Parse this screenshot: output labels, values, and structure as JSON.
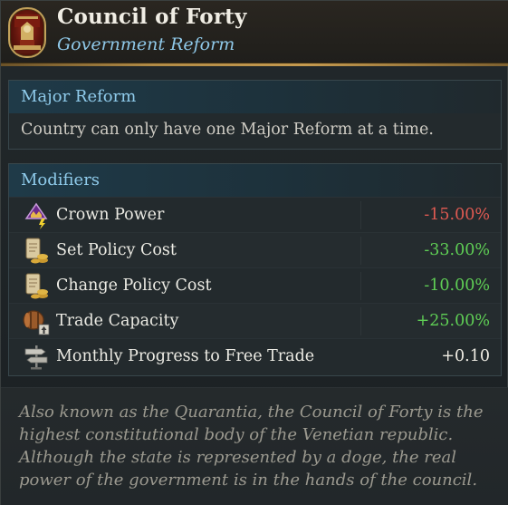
{
  "header": {
    "title": "Council of Forty",
    "subtitle": "Government Reform",
    "emblem_icon": "council-throne-icon",
    "accent_color": "#c59a4f"
  },
  "major_reform": {
    "heading": "Major Reform",
    "text": "Country can only have one Major Reform at a time."
  },
  "modifiers": {
    "heading": "Modifiers",
    "items": [
      {
        "icon": "crown-power-icon",
        "label": "Crown Power",
        "value": "-15.00%",
        "tone": "negative"
      },
      {
        "icon": "policy-scroll-coins-icon",
        "label": "Set Policy Cost",
        "value": "-33.00%",
        "tone": "positive"
      },
      {
        "icon": "policy-scroll-coins-icon",
        "label": "Change Policy Cost",
        "value": "-10.00%",
        "tone": "positive"
      },
      {
        "icon": "trade-barrel-icon",
        "label": "Trade Capacity",
        "value": "+25.00%",
        "tone": "positive"
      },
      {
        "icon": "signpost-icon",
        "label": "Monthly Progress to Free Trade",
        "value": "+0.10",
        "tone": "neutral"
      }
    ]
  },
  "lore": "Also known as the Quarantia, the Council of Forty is the highest constitutional body of the Venetian republic. Although the state is represented by a doge, the real power of the government is in the hands of the council.",
  "colors": {
    "negative": "#e05a52",
    "positive": "#5fcf55",
    "neutral": "#f0ede4",
    "heading": "#8fcbeb"
  }
}
